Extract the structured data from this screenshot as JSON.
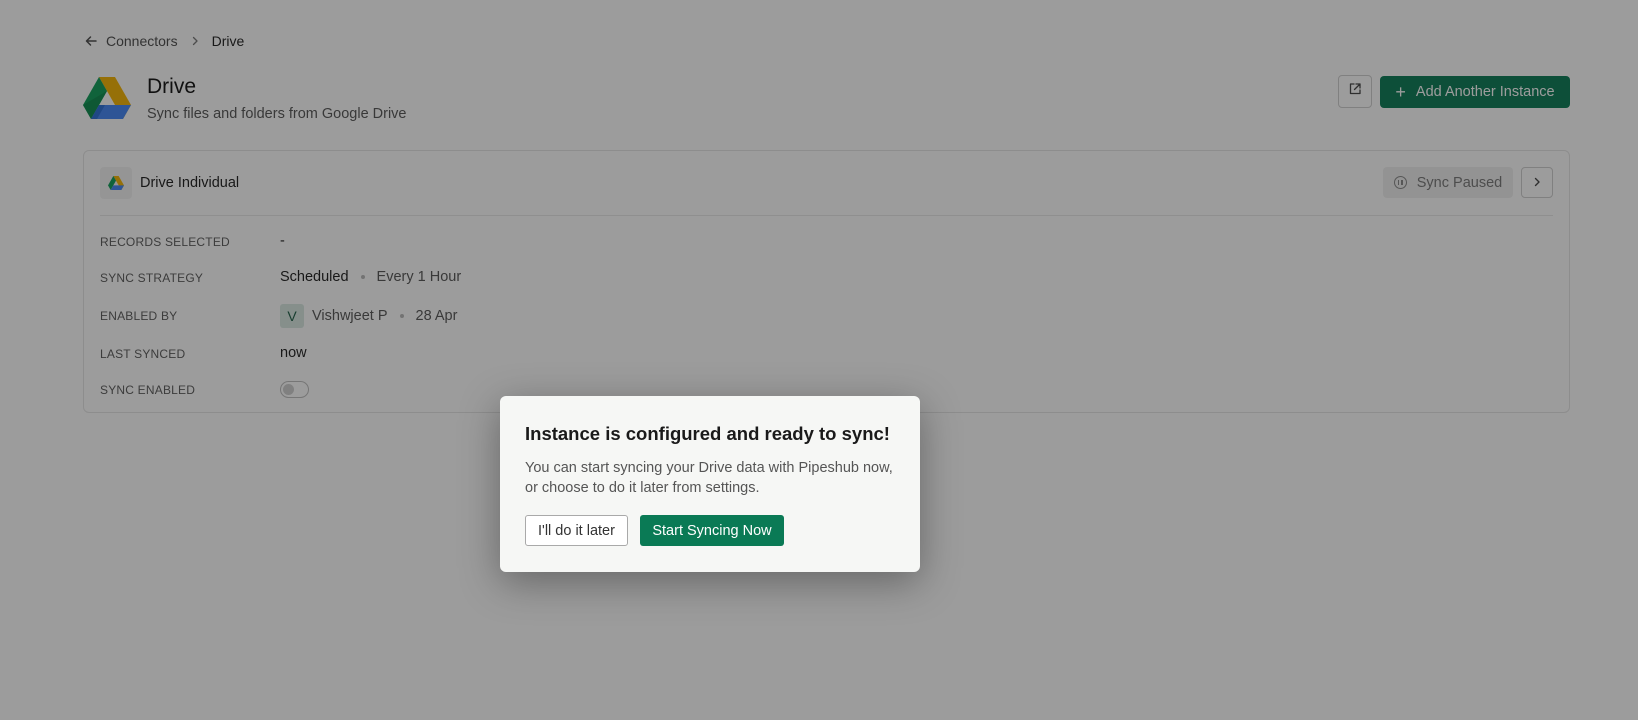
{
  "breadcrumb": {
    "parent": "Connectors",
    "current": "Drive"
  },
  "header": {
    "title": "Drive",
    "subtitle": "Sync files and folders from Google Drive",
    "add_instance_label": "Add Another Instance"
  },
  "instance": {
    "name": "Drive Individual",
    "status_label": "Sync Paused",
    "rows": {
      "records_selected": {
        "label": "RECORDS SELECTED",
        "value": "-"
      },
      "sync_strategy": {
        "label": "SYNC STRATEGY",
        "value": "Scheduled",
        "interval": "Every 1 Hour"
      },
      "enabled_by": {
        "label": "ENABLED BY",
        "avatar_initial": "V",
        "user": "Vishwjeet P",
        "date": "28 Apr"
      },
      "last_synced": {
        "label": "LAST SYNCED",
        "value": "now"
      },
      "sync_enabled": {
        "label": "SYNC ENABLED",
        "value": false
      }
    }
  },
  "modal": {
    "title": "Instance is configured and ready to sync!",
    "body": "You can start syncing your Drive data with Pipeshub now, or choose to do it later from settings.",
    "later_label": "I'll do it later",
    "start_label": "Start Syncing Now"
  },
  "colors": {
    "accent": "#0a7a55",
    "overlay": "rgba(20,20,20,0.42)"
  },
  "icons": {
    "back": "arrow-left-icon",
    "separator": "chevron-right-icon",
    "external": "external-link-icon",
    "add": "plus-icon",
    "status": "pause-circle-icon",
    "open": "chevron-right-icon"
  }
}
